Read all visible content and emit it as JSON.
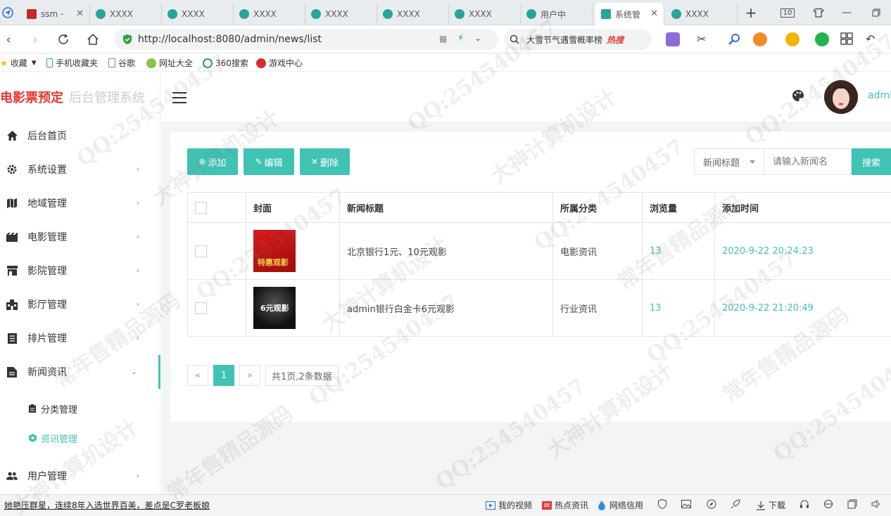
{
  "browser": {
    "tabs": [
      {
        "label": "ssm - ",
        "color": "#c62828",
        "active": false
      },
      {
        "label": "XXXX",
        "color": "#26a69a",
        "active": false
      },
      {
        "label": "XXXX",
        "color": "#26a69a",
        "active": false
      },
      {
        "label": "XXXX",
        "color": "#26a69a",
        "active": false
      },
      {
        "label": "XXXX",
        "color": "#26a69a",
        "active": false
      },
      {
        "label": "XXXX",
        "color": "#26a69a",
        "active": false
      },
      {
        "label": "XXXX",
        "color": "#26a69a",
        "active": false
      },
      {
        "label": "用户中",
        "color": "#26a69a",
        "active": false
      },
      {
        "label": "系统管",
        "color": "#26a69a",
        "active": true
      },
      {
        "label": "XXXX",
        "color": "#26a69a",
        "active": false
      }
    ],
    "tab_count": "10",
    "url": "http://localhost:8080/admin/news/list",
    "search_hint": "大雪节气遇雪概率榜",
    "search_hot": "热搜",
    "bookmarks": [
      "收藏",
      "手机收藏夹",
      "谷歌",
      "网址大全",
      "360搜索",
      "游戏中心"
    ]
  },
  "sidebar": {
    "brand": "电影票预定",
    "brand_sub": "后台管理系统",
    "items": [
      {
        "label": "后台首页",
        "icon": "home-icon"
      },
      {
        "label": "系统设置",
        "icon": "gear-icon"
      },
      {
        "label": "地域管理",
        "icon": "map-icon"
      },
      {
        "label": "电影管理",
        "icon": "film-icon"
      },
      {
        "label": "影院管理",
        "icon": "store-icon"
      },
      {
        "label": "影厅管理",
        "icon": "building-icon"
      },
      {
        "label": "排片管理",
        "icon": "schedule-icon"
      },
      {
        "label": "新闻资讯",
        "icon": "news-icon"
      },
      {
        "label": "用户管理",
        "icon": "users-icon"
      }
    ],
    "sub_items": [
      {
        "label": "分类管理",
        "icon": "clipboard-icon"
      },
      {
        "label": "资讯管理",
        "icon": "info-icon"
      }
    ]
  },
  "topbar": {
    "username": "admi"
  },
  "toolbar": {
    "add": "添加",
    "edit": "编辑",
    "delete": "删除",
    "filter_field": "新闻标题",
    "search_placeholder": "请输入新闻名",
    "search": "搜索"
  },
  "table": {
    "headers": [
      "封面",
      "新闻标题",
      "所属分类",
      "浏览量",
      "添加时间"
    ],
    "rows": [
      {
        "cover_text": "特惠观影",
        "title": "北京银行1元、10元观影",
        "category": "电影资讯",
        "views": "13",
        "time": "2020-9-22 20:24:23"
      },
      {
        "cover_text": "6元观影",
        "title": "admin银行白金卡6元观影",
        "category": "行业资讯",
        "views": "13",
        "time": "2020-9-22 21:20:49"
      }
    ]
  },
  "pagination": {
    "prev": "«",
    "current": "1",
    "next": "»",
    "info": "共1页,2条数据"
  },
  "statusbar": {
    "ticker": "她艳压群星，连续8年入选世界百美，差点是C罗老板娘",
    "items": [
      "我的视频",
      "热点资讯",
      "网络信用",
      "下载"
    ]
  },
  "watermarks": [
    "QQ:254540457",
    "大神计算机设计",
    "常年售精品源码"
  ],
  "colors": {
    "accent": "#40c3b3",
    "brand": "#e53935"
  }
}
